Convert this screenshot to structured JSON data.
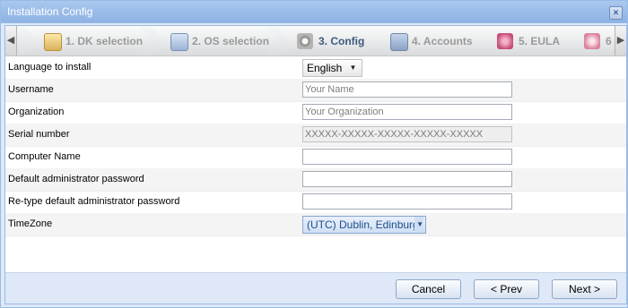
{
  "window": {
    "title": "Installation Config"
  },
  "steps": [
    {
      "label": "1. DK selection",
      "icon": "package-icon",
      "active": false
    },
    {
      "label": "2. OS selection",
      "icon": "window-icon",
      "active": false
    },
    {
      "label": "3. Config",
      "icon": "gear-icon",
      "active": true
    },
    {
      "label": "4. Accounts",
      "icon": "users-icon",
      "active": false
    },
    {
      "label": "5. EULA",
      "icon": "eula-icon",
      "active": false
    },
    {
      "label": "6",
      "icon": "step-six-icon",
      "active": false
    }
  ],
  "form": {
    "language": {
      "label": "Language to install",
      "value": "English"
    },
    "username": {
      "label": "Username",
      "placeholder": "Your Name"
    },
    "organization": {
      "label": "Organization",
      "placeholder": "Your Organization"
    },
    "serial": {
      "label": "Serial number",
      "placeholder": "XXXXX-XXXXX-XXXXX-XXXXX-XXXXX"
    },
    "computer_name": {
      "label": "Computer Name",
      "value": ""
    },
    "admin_password": {
      "label": "Default administrator password",
      "value": ""
    },
    "admin_password_retype": {
      "label": "Re-type default administrator password",
      "value": ""
    },
    "timezone": {
      "label": "TimeZone",
      "value": "(UTC) Dublin, Edinburg"
    }
  },
  "buttons": {
    "cancel": "Cancel",
    "prev": "< Prev",
    "next": "Next >"
  },
  "colors": {
    "title_bar": "#8db2e3",
    "active_step": "#3d5a7e",
    "footer": "#dfe8f6"
  }
}
